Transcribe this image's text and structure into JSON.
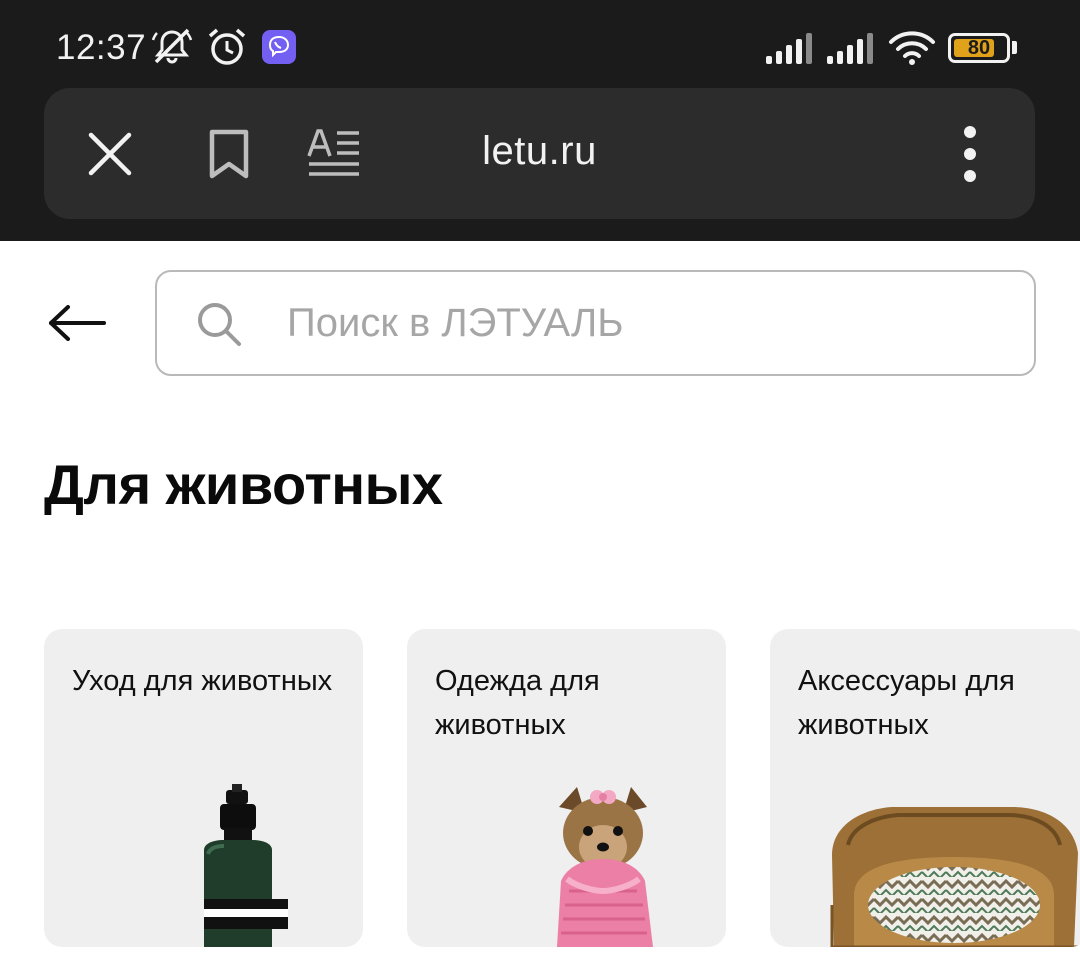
{
  "status_bar": {
    "time": "12:37",
    "battery_percent": "80",
    "battery_level": 0.8,
    "icons": [
      "bell-muted-icon",
      "alarm-icon",
      "viber-icon",
      "signal-sim1-icon",
      "signal-sim2-icon",
      "wifi-icon",
      "battery-icon"
    ]
  },
  "browser": {
    "url": "letu.ru",
    "icons": [
      "close-icon",
      "bookmark-icon",
      "reader-mode-icon",
      "more-vertical-icon"
    ]
  },
  "search": {
    "placeholder": "Поиск в ЛЭТУАЛЬ",
    "value": ""
  },
  "page": {
    "title": "Для животных"
  },
  "categories": [
    {
      "label": "Уход для животных",
      "image": "spray-bottle-image"
    },
    {
      "label": "Одежда для животных",
      "image": "dog-in-sweater-image"
    },
    {
      "label": "Аксессуары для животных",
      "image": "pet-bed-image"
    }
  ],
  "colors": {
    "chrome_bg": "#1b1b1b",
    "urlbar_bg": "#2c2c2c",
    "card_bg": "#efefef",
    "viber": "#7360f2",
    "battery_fill": "#e0a21a"
  }
}
